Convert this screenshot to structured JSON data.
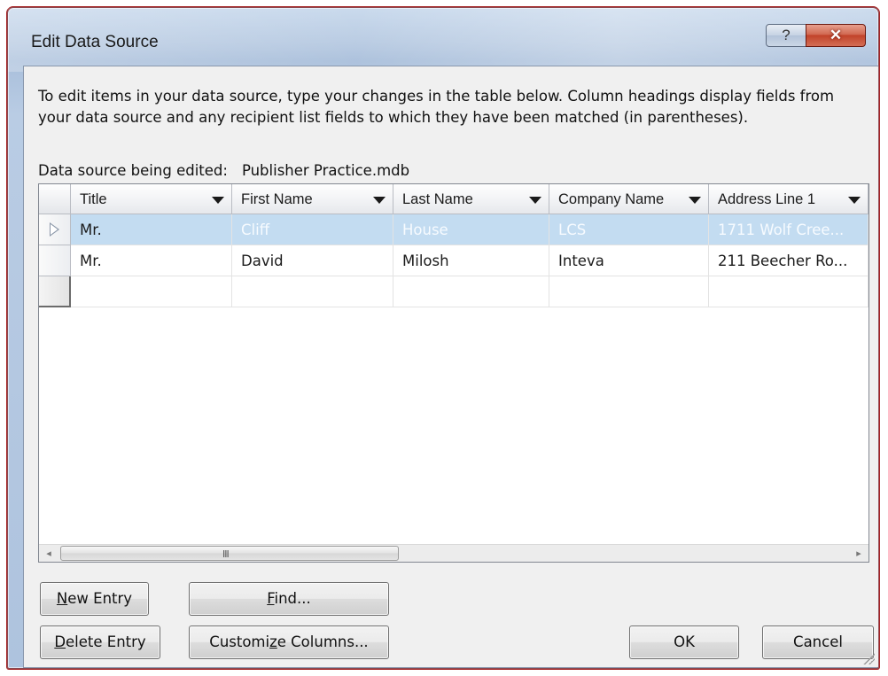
{
  "window": {
    "title": "Edit Data Source",
    "help_glyph": "?",
    "close_glyph": "✕"
  },
  "instructions": "To edit items in your data source, type your changes in the table below. Column headings display fields from your data source and any recipient list fields to which they have been matched (in parentheses).",
  "source": {
    "label": "Data source being edited:",
    "value": "Publisher Practice.mdb"
  },
  "table": {
    "columns": [
      "Title",
      "First Name",
      "Last Name",
      "Company Name",
      "Address Line 1"
    ],
    "rows": [
      [
        "Mr.",
        "Cliff",
        "House",
        "LCS",
        "1711 Wolf Cree..."
      ],
      [
        "Mr.",
        "David",
        "Milosh",
        "Inteva",
        "211 Beecher Ro..."
      ],
      [
        "",
        "",
        "",
        "",
        ""
      ]
    ],
    "selected_row": 0
  },
  "scrollbar": {
    "left_glyph": "◂",
    "right_glyph": "▸",
    "grip_glyph": "III"
  },
  "buttons": {
    "new_entry_accel": "N",
    "new_entry_rest": "ew Entry",
    "find_accel": "F",
    "find_rest": "ind...",
    "delete_entry_accel": "D",
    "delete_entry_rest": "elete Entry",
    "customize_pre": "Customi",
    "customize_accel": "z",
    "customize_post": "e Columns...",
    "ok": "OK",
    "cancel": "Cancel"
  }
}
